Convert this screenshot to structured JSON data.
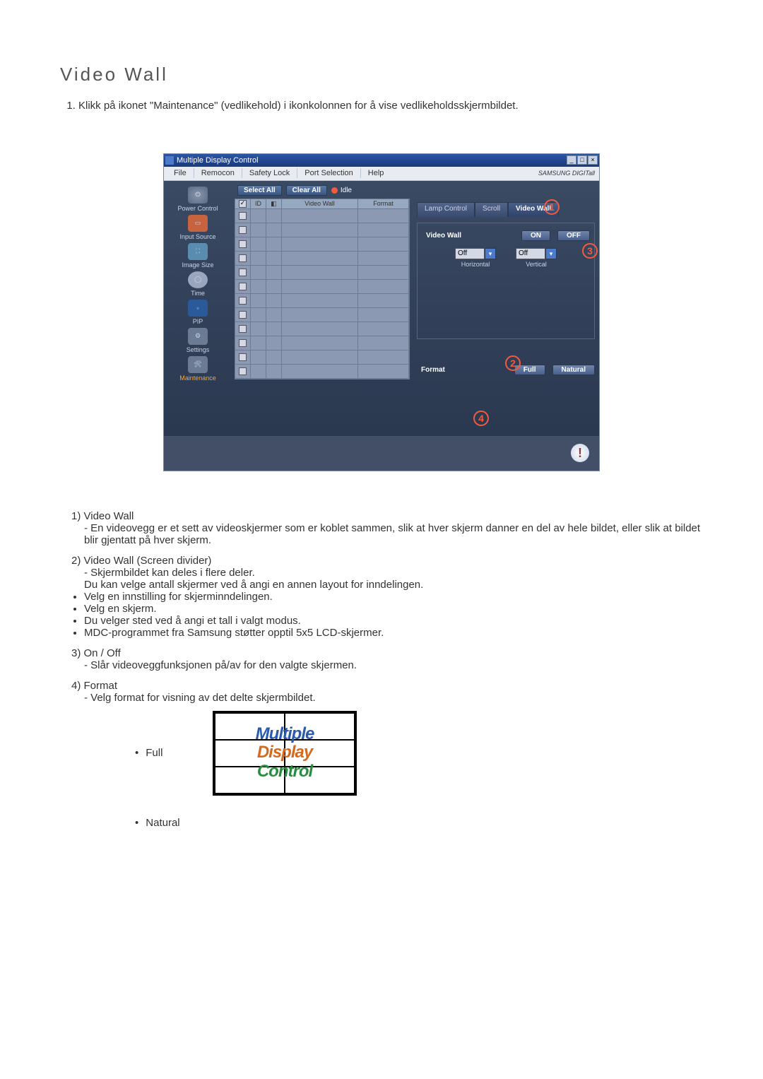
{
  "title": "Video Wall",
  "instruction1": "Klikk på ikonet \"Maintenance\" (vedlikehold) i ikonkolonnen for å vise vedlikeholdsskjermbildet.",
  "app": {
    "window_title": "Multiple Display Control",
    "brand": "SAMSUNG DIGITall",
    "menu": [
      "File",
      "Remocon",
      "Safety Lock",
      "Port Selection",
      "Help"
    ],
    "toolbar": {
      "select_all": "Select All",
      "clear_all": "Clear All",
      "idle": "Idle"
    },
    "grid_headers": {
      "id": "ID",
      "video_wall": "Video Wall",
      "format": "Format"
    },
    "sidebar": [
      {
        "label": "Power Control"
      },
      {
        "label": "Input Source"
      },
      {
        "label": "Image Size"
      },
      {
        "label": "Time"
      },
      {
        "label": "PIP"
      },
      {
        "label": "Settings"
      },
      {
        "label": "Maintenance"
      }
    ],
    "tabs": {
      "lamp": "Lamp Control",
      "scroll": "Scroll",
      "videowall": "Video Wall"
    },
    "panel": {
      "video_wall_label": "Video Wall",
      "on": "ON",
      "off": "OFF",
      "horizontal": "Horizontal",
      "vertical": "Vertical",
      "h_value": "Off",
      "v_value": "Off",
      "format_label": "Format",
      "full": "Full",
      "natural": "Natural"
    },
    "alert": "!"
  },
  "notes": {
    "n1_title": "1) Video Wall",
    "n1_body": "- En videovegg er et sett av videoskjermer som er koblet sammen, slik at hver skjerm danner en del av hele bildet, eller slik at bildet blir gjentatt på hver skjerm.",
    "n2_title": "2) Video Wall (Screen divider)",
    "n2_body1": "- Skjermbildet kan deles i flere deler.",
    "n2_body2": "Du kan velge antall skjermer ved å angi en annen layout for inndelingen.",
    "n2_bullets": [
      "Velg en innstilling for skjerminndelingen.",
      "Velg en skjerm.",
      "Du velger sted ved å angi et tall i valgt modus.",
      "MDC-programmet fra Samsung støtter opptil 5x5 LCD-skjermer."
    ],
    "n3_title": "3) On / Off",
    "n3_body": "- Slår videoveggfunksjonen på/av for den valgte skjermen.",
    "n4_title": "4) Format",
    "n4_body": "- Velg format for visning av det delte skjermbildet.",
    "full": "Full",
    "natural": "Natural",
    "diagram": {
      "l1": "Multiple",
      "l2": "Display",
      "l3": "Control"
    }
  }
}
